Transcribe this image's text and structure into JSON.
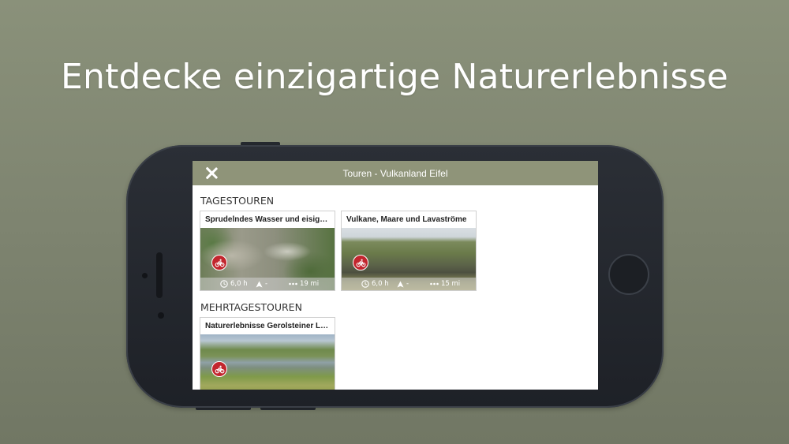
{
  "headline": "Entdecke einzigartige Naturerlebnisse",
  "topbar": {
    "title": "Touren - Vulkanland Eifel",
    "close_icon": "close-icon"
  },
  "sections": [
    {
      "title": "TAGESTOUREN",
      "cards": [
        {
          "title": "Sprudelndes Wasser und eisigen Höhlen",
          "duration": "6,0 h",
          "ascent": "-",
          "distance": "19 mi",
          "activity_icon": "bike-icon"
        },
        {
          "title": "Vulkane, Maare und Lavaströme",
          "duration": "6,0 h",
          "ascent": "-",
          "distance": "15 mi",
          "activity_icon": "bike-icon"
        }
      ]
    },
    {
      "title": "MEHRTAGESTOUREN",
      "cards": [
        {
          "title": "Naturerlebnisse Gerolsteiner Land",
          "activity_icon": "bike-icon"
        }
      ]
    }
  ],
  "colors": {
    "background": "#7e8470",
    "topbar": "#8f9479",
    "activity_badge": "#c2262e"
  }
}
